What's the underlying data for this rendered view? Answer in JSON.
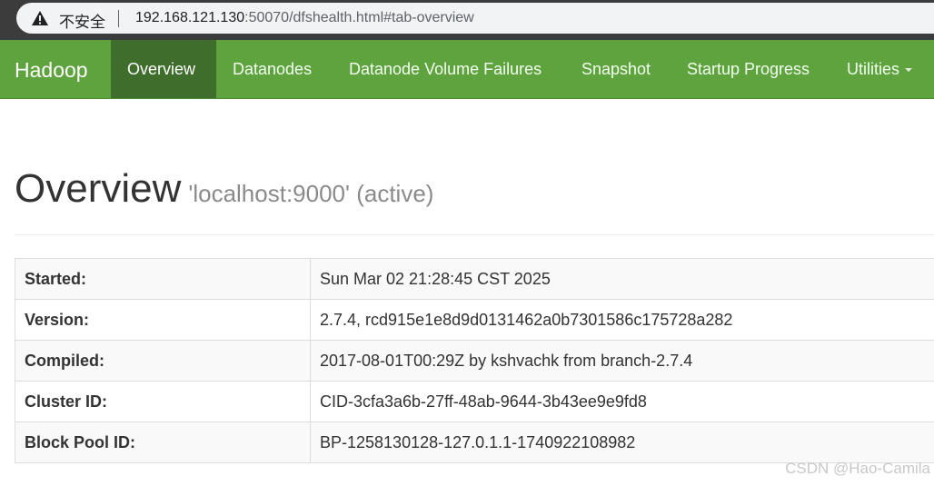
{
  "browser": {
    "insecure_label": "不安全",
    "url_host": "192.168.121.130",
    "url_rest": ":50070/dfshealth.html#tab-overview"
  },
  "navbar": {
    "brand": "Hadoop",
    "items": [
      {
        "label": "Overview",
        "active": true
      },
      {
        "label": "Datanodes"
      },
      {
        "label": "Datanode Volume Failures"
      },
      {
        "label": "Snapshot"
      },
      {
        "label": "Startup Progress"
      },
      {
        "label": "Utilities",
        "has_dropdown": true
      }
    ],
    "colors": {
      "bar": "#5fa33e",
      "active": "#3f6e2c"
    }
  },
  "page": {
    "title": "Overview",
    "subtitle": "'localhost:9000' (active)"
  },
  "info_table": [
    {
      "key": "Started:",
      "value": "Sun Mar 02 21:28:45 CST 2025"
    },
    {
      "key": "Version:",
      "value": "2.7.4, rcd915e1e8d9d0131462a0b7301586c175728a282"
    },
    {
      "key": "Compiled:",
      "value": "2017-08-01T00:29Z by kshvachk from branch-2.7.4"
    },
    {
      "key": "Cluster ID:",
      "value": "CID-3cfa3a6b-27ff-48ab-9644-3b43ee9e9fd8"
    },
    {
      "key": "Block Pool ID:",
      "value": "BP-1258130128-127.0.1.1-1740922108982"
    }
  ],
  "watermark": "CSDN @Hao-Camila"
}
